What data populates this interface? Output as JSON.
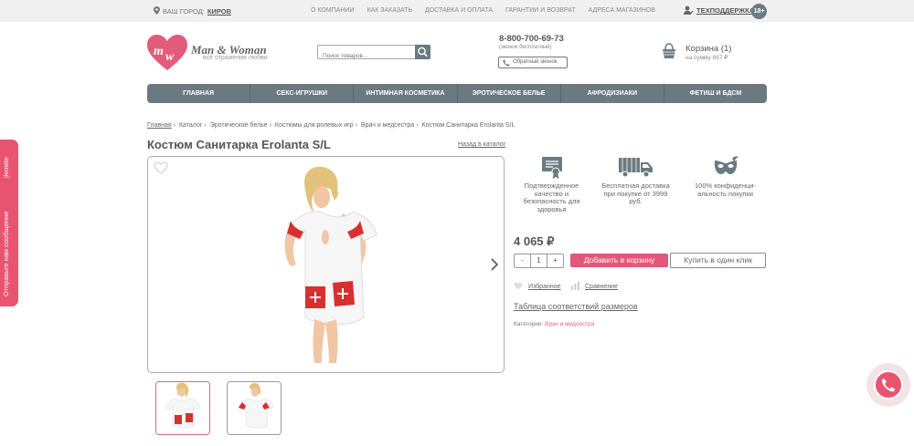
{
  "topbar": {
    "city_label": "ВАШ ГОРОД:",
    "city": "КИРОВ",
    "links": [
      "О КОМПАНИИ",
      "КАК ЗАКАЗАТЬ",
      "ДОСТАВКА И ОПЛАТА",
      "ГАРАНТИИ И ВОЗВРАТ",
      "АДРЕСА МАГАЗИНОВ"
    ],
    "support": "ТЕХПОДДЕРЖКА",
    "age": "18+"
  },
  "header": {
    "logo_text": "Man & Woman",
    "logo_sub": "все отражения любви",
    "search_placeholder": "Поиск товаров...",
    "phone": "8-800-700-69-73",
    "phone_note": "(звонок бесплатный)",
    "callback": "Обратный звонок",
    "cart_title": "Корзина (1)",
    "cart_sum": "на сумму 897 ₽"
  },
  "nav": [
    "ГЛАВНАЯ",
    "СЕКС-ИГРУШКИ",
    "ИНТИМНАЯ КОСМЕТИКА",
    "ЭРОТИЧЕСКОЕ БЕЛЬЕ",
    "АФРОДИЗИАКИ",
    "ФЕТИШ И БДСМ"
  ],
  "breadcrumbs": [
    "Главная",
    "Каталог",
    "Эротическое белье",
    "Костюмы для ролевых игр",
    "Врач и медсестра",
    "Костюм Санитарка Erolanta S/L"
  ],
  "product": {
    "title": "Костюм Санитарка Erolanta S/L",
    "back": "Назад в каталог",
    "price": "4 065 ₽",
    "qty_minus": "-",
    "qty": "1",
    "qty_plus": "+",
    "add_to_cart": "Добавить в корзину",
    "buy_one_click": "Купить в один клик",
    "favorite": "Избранное",
    "compare": "Сравнение",
    "size_table": "Таблица соответствий размеров",
    "category_label": "Категории:",
    "category": "Врач и медсестра"
  },
  "features": [
    {
      "icon": "certificate-icon",
      "text": "Подтвержденное качество и безопасность для здоровья"
    },
    {
      "icon": "truck-icon",
      "text": "Бесплатная доставка при покупке от 3999 руб."
    },
    {
      "icon": "mask-icon",
      "text": "100% конфиденци-альность покупки"
    }
  ],
  "side_tab": {
    "text": "Отправьте нам сообщение",
    "brand": "jivosite"
  },
  "colors": {
    "accent": "#e8546f",
    "nav_bg": "#6b7a80"
  }
}
